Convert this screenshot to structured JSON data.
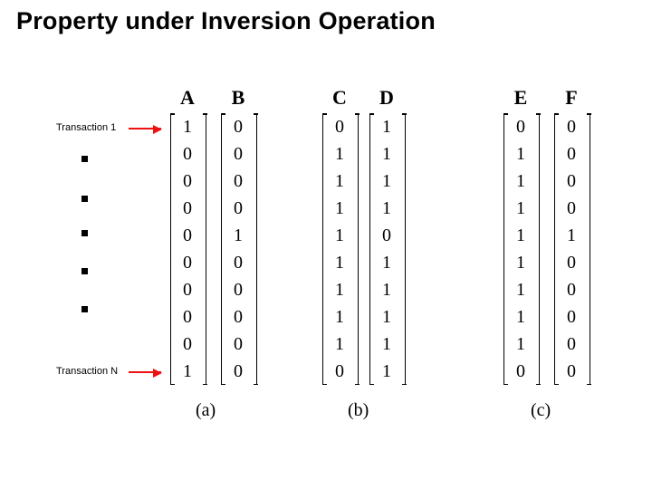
{
  "title": "Property under Inversion Operation",
  "annotations": {
    "first": "Transaction 1",
    "last": "Transaction N"
  },
  "chart_data": {
    "type": "table",
    "title": "Property under Inversion Operation",
    "row_labels_note": "Rows are transactions 1..N (N=10 shown)",
    "panels": [
      {
        "label": "(a)",
        "columns": [
          {
            "name": "A",
            "values": [
              1,
              0,
              0,
              0,
              0,
              0,
              0,
              0,
              0,
              1
            ]
          },
          {
            "name": "B",
            "values": [
              0,
              0,
              0,
              0,
              1,
              0,
              0,
              0,
              0,
              0
            ]
          }
        ]
      },
      {
        "label": "(b)",
        "columns": [
          {
            "name": "C",
            "values": [
              0,
              1,
              1,
              1,
              1,
              1,
              1,
              1,
              1,
              0
            ]
          },
          {
            "name": "D",
            "values": [
              1,
              1,
              1,
              1,
              0,
              1,
              1,
              1,
              1,
              1
            ]
          }
        ]
      },
      {
        "label": "(c)",
        "columns": [
          {
            "name": "E",
            "values": [
              0,
              1,
              1,
              1,
              1,
              1,
              1,
              1,
              1,
              0
            ]
          },
          {
            "name": "F",
            "values": [
              0,
              0,
              0,
              0,
              1,
              0,
              0,
              0,
              0,
              0
            ]
          }
        ]
      }
    ]
  },
  "layout": {
    "col_x": {
      "A": 192,
      "B": 248,
      "C": 360,
      "D": 412,
      "E": 560,
      "F": 616
    },
    "panel_caption_x": {
      "a": 216,
      "b": 384,
      "c": 586
    },
    "dot_y": [
      172,
      216,
      254,
      296,
      338
    ]
  }
}
